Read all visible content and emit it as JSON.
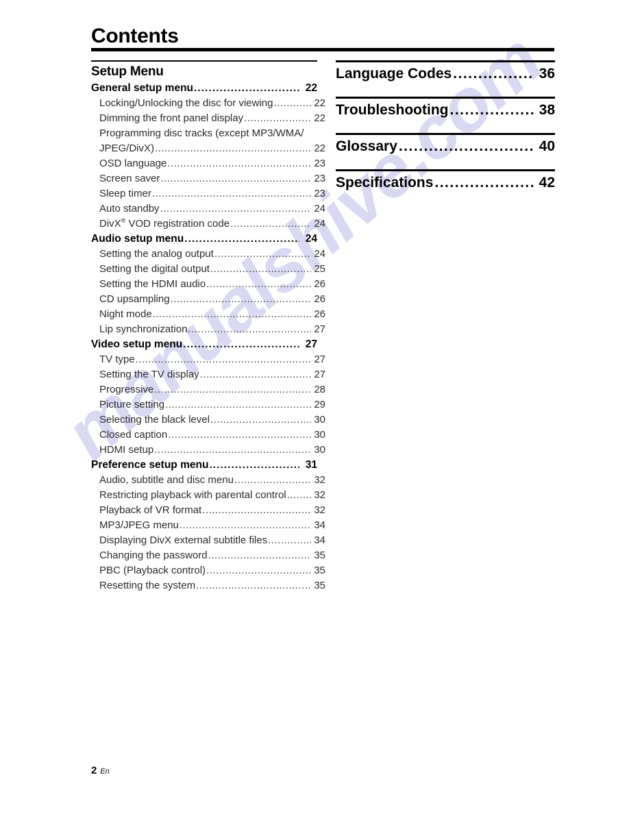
{
  "document": {
    "title": "Contents",
    "footer": {
      "page_number": "2",
      "language_code": "En"
    },
    "watermark": {
      "text": "manualshive.com",
      "color": "#d8d9f2"
    }
  },
  "left_column": {
    "section_title": "Setup Menu",
    "entries": [
      {
        "level": 1,
        "label": "General setup menu",
        "page": "22"
      },
      {
        "level": 2,
        "label": "Locking/Unlocking the disc for viewing",
        "page": "22"
      },
      {
        "level": 2,
        "label": "Dimming the front panel display",
        "page": "22"
      },
      {
        "level": 2,
        "label": "Programming disc tracks (except MP3/WMA/",
        "page": "",
        "wrap_first": true
      },
      {
        "level": 2,
        "label": "JPEG/DivX)",
        "page": "22",
        "wrap_cont": true
      },
      {
        "level": 2,
        "label": "OSD language",
        "page": "23"
      },
      {
        "level": 2,
        "label": "Screen saver",
        "page": "23"
      },
      {
        "level": 2,
        "label": "Sleep timer",
        "page": "23"
      },
      {
        "level": 2,
        "label": "Auto standby",
        "page": "24"
      },
      {
        "level": 2,
        "label": "DivX® VOD registration code",
        "page": "24",
        "has_sup": true,
        "label_pre": "DivX",
        "label_post": " VOD registration code"
      },
      {
        "level": 1,
        "label": "Audio setup menu",
        "page": "24"
      },
      {
        "level": 2,
        "label": "Setting the analog output",
        "page": "24"
      },
      {
        "level": 2,
        "label": "Setting the digital output",
        "page": "25"
      },
      {
        "level": 2,
        "label": "Setting the HDMI audio",
        "page": "26"
      },
      {
        "level": 2,
        "label": "CD upsampling",
        "page": "26"
      },
      {
        "level": 2,
        "label": "Night mode",
        "page": "26"
      },
      {
        "level": 2,
        "label": "Lip synchronization",
        "page": "27"
      },
      {
        "level": 1,
        "label": "Video setup menu",
        "page": "27"
      },
      {
        "level": 2,
        "label": "TV type",
        "page": "27"
      },
      {
        "level": 2,
        "label": "Setting the TV display",
        "page": "27"
      },
      {
        "level": 2,
        "label": "Progressive",
        "page": "28"
      },
      {
        "level": 2,
        "label": "Picture setting",
        "page": "29"
      },
      {
        "level": 2,
        "label": "Selecting the black level",
        "page": "30"
      },
      {
        "level": 2,
        "label": "Closed caption",
        "page": "30"
      },
      {
        "level": 2,
        "label": "HDMI setup",
        "page": "30"
      },
      {
        "level": 1,
        "label": "Preference setup menu",
        "page": "31"
      },
      {
        "level": 2,
        "label": "Audio, subtitle and disc menu",
        "page": "32"
      },
      {
        "level": 2,
        "label": "Restricting playback with parental control",
        "page": "32"
      },
      {
        "level": 2,
        "label": "Playback of VR format",
        "page": "32"
      },
      {
        "level": 2,
        "label": "MP3/JPEG menu",
        "page": "34"
      },
      {
        "level": 2,
        "label": "Displaying DivX external subtitle files",
        "page": "34"
      },
      {
        "level": 2,
        "label": "Changing the password",
        "page": "35"
      },
      {
        "level": 2,
        "label": "PBC (Playback control)",
        "page": "35"
      },
      {
        "level": 2,
        "label": "Resetting the system",
        "page": "35"
      }
    ]
  },
  "right_column": {
    "entries": [
      {
        "label": "Language Codes",
        "page": "36"
      },
      {
        "label": "Troubleshooting",
        "page": "38"
      },
      {
        "label": "Glossary",
        "page": "40"
      },
      {
        "label": "Specifications",
        "page": "42"
      }
    ]
  },
  "leader_dots": "...................................................................................................................................................................."
}
